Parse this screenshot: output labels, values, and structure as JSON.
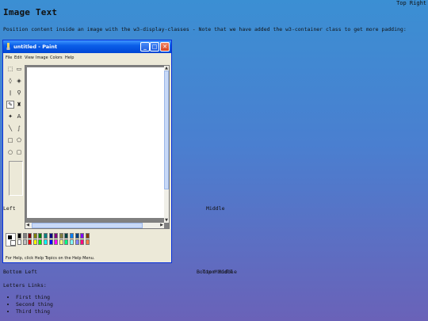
{
  "page": {
    "title": "Image Text",
    "top_right": "Top Right",
    "intro": "Position content inside an image with the w3-display-classes - Note that we have added the w3-container class to get more padding:",
    "middle": "Middle",
    "left": "Left",
    "bottom_left": "Bottom Left",
    "bottom_middle": "Bottom Middle",
    "bottom_middle_2": "Top Middle",
    "links_label": "Letters Links:",
    "links": [
      "First thing",
      "Second thing",
      "Third thing"
    ]
  },
  "paint": {
    "title": "untitled - Paint",
    "menu": [
      "File",
      "Edit",
      "View",
      "Image",
      "Colors",
      "Help"
    ],
    "tools": [
      {
        "icon": "free-select-icon",
        "glyph": "⬚"
      },
      {
        "icon": "rect-select-icon",
        "glyph": "▭"
      },
      {
        "icon": "eraser-icon",
        "glyph": "◊"
      },
      {
        "icon": "fill-icon",
        "glyph": "◈"
      },
      {
        "icon": "eyedropper-icon",
        "glyph": "ǀ"
      },
      {
        "icon": "magnifier-icon",
        "glyph": "⚲"
      },
      {
        "icon": "pencil-icon",
        "glyph": "✎"
      },
      {
        "icon": "brush-icon",
        "glyph": "♜"
      },
      {
        "icon": "airbrush-icon",
        "glyph": "✦"
      },
      {
        "icon": "text-icon",
        "glyph": "A"
      },
      {
        "icon": "line-icon",
        "glyph": "╲"
      },
      {
        "icon": "curve-icon",
        "glyph": "∫"
      },
      {
        "icon": "rectangle-icon",
        "glyph": "□"
      },
      {
        "icon": "polygon-icon",
        "glyph": "⬠"
      },
      {
        "icon": "ellipse-icon",
        "glyph": "○"
      },
      {
        "icon": "rounded-rect-icon",
        "glyph": "▢"
      }
    ],
    "selected_tool": "pencil-icon",
    "palette_top": [
      "#000000",
      "#808080",
      "#800000",
      "#808000",
      "#008000",
      "#008080",
      "#000080",
      "#800080",
      "#808040",
      "#004040",
      "#0080ff",
      "#004080",
      "#8000ff",
      "#804000"
    ],
    "palette_bottom": [
      "#ffffff",
      "#c0c0c0",
      "#ff0000",
      "#ffff00",
      "#00ff00",
      "#00ffff",
      "#0000ff",
      "#ff00ff",
      "#ffff80",
      "#00ff80",
      "#80ffff",
      "#8080ff",
      "#ff0080",
      "#ff8040"
    ],
    "status": "For Help, click Help Topics on the Help Menu.",
    "colors": {
      "titlebar": "#0a5ee8",
      "window": "#ece9d8",
      "close": "#d8431f"
    }
  }
}
